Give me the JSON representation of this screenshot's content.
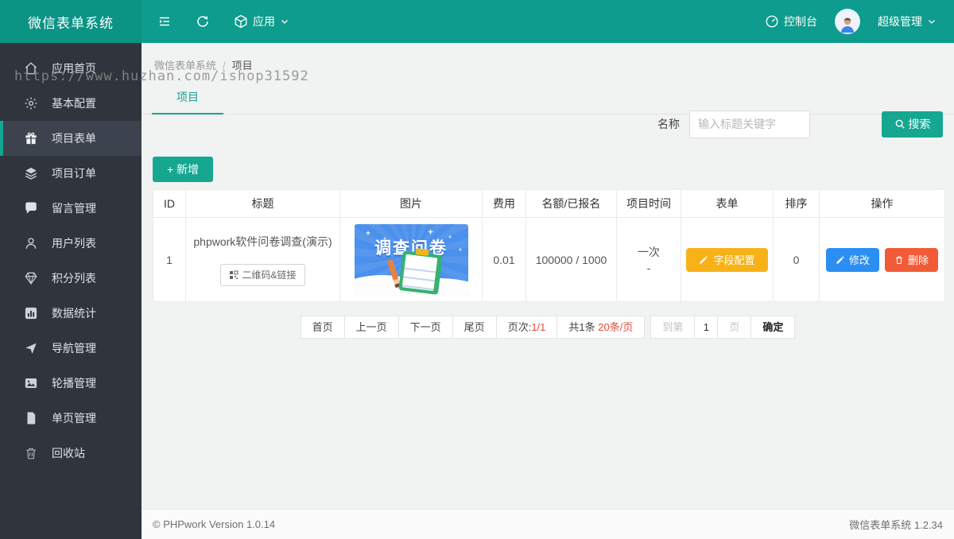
{
  "colors": {
    "accent_teal": "#0d9c8d",
    "button_teal": "#16a791",
    "sidebar_dark": "#2f343d",
    "blue_button": "#2b8ef3",
    "red_button": "#f25b38",
    "amber_button": "#f8b217",
    "pagination_red": "#e84a3a",
    "promo_blue": "#4a90ec"
  },
  "header": {
    "logo": "微信表单系统",
    "collapse_icon": "collapse-icon",
    "refresh_icon": "refresh-icon",
    "app_menu": {
      "label": "应用",
      "icon": "app-box-icon",
      "chevron": "chevron-down-icon"
    },
    "console": {
      "label": "控制台",
      "icon": "gauge-icon"
    },
    "user": {
      "label": "超级管理",
      "avatar": "user-avatar",
      "chevron": "chevron-down-icon"
    }
  },
  "sidebar": {
    "items": [
      {
        "label": "应用首页",
        "icon": "home-icon",
        "active": false
      },
      {
        "label": "基本配置",
        "icon": "gear-icon",
        "active": false
      },
      {
        "label": "项目表单",
        "icon": "gift-icon",
        "active": true
      },
      {
        "label": "项目订单",
        "icon": "layers-icon",
        "active": false
      },
      {
        "label": "留言管理",
        "icon": "comment-icon",
        "active": false
      },
      {
        "label": "用户列表",
        "icon": "user-icon",
        "active": false
      },
      {
        "label": "积分列表",
        "icon": "gem-icon",
        "active": false
      },
      {
        "label": "数据统计",
        "icon": "chart-icon",
        "active": false
      },
      {
        "label": "导航管理",
        "icon": "nav-icon",
        "active": false
      },
      {
        "label": "轮播管理",
        "icon": "carousel-icon",
        "active": false
      },
      {
        "label": "单页管理",
        "icon": "page-icon",
        "active": false
      },
      {
        "label": "回收站",
        "icon": "trash-icon",
        "active": false
      }
    ]
  },
  "watermark": "https://www.huzhan.com/ishop31592",
  "breadcrumb": {
    "root": "微信表单系统",
    "separator": "/",
    "current": "项目"
  },
  "tabs": {
    "active": "项目"
  },
  "search": {
    "label": "名称",
    "placeholder": "输入标题关键字",
    "button": "搜索"
  },
  "toolbar": {
    "add_button": "+ 新增"
  },
  "table": {
    "columns": [
      "ID",
      "标题",
      "图片",
      "费用",
      "名额/已报名",
      "项目时间",
      "表单",
      "排序",
      "操作"
    ],
    "rows": [
      {
        "id": "1",
        "title": "phpwork软件问卷调查(演示)",
        "qr_button": "二维码&链接",
        "image_text": "调查问卷",
        "fee": "0.01",
        "quota": "100000 / 1000",
        "time_line1": "一次",
        "time_line2": "-",
        "form_button": "字段配置",
        "sort": "0",
        "edit_button": "修改",
        "delete_button": "删除"
      }
    ]
  },
  "pagination": {
    "first": "首页",
    "prev": "上一页",
    "next": "下一页",
    "last": "尾页",
    "page_info_label": "页次:",
    "page_info_value": "1/1",
    "total_label": "共1条",
    "per_page": "20条/页",
    "goto_label": "到第",
    "goto_value": "1",
    "goto_unit": "页",
    "confirm": "确定"
  },
  "footer": {
    "left": "© PHPwork Version 1.0.14",
    "right": "微信表单系统 1.2.34"
  }
}
